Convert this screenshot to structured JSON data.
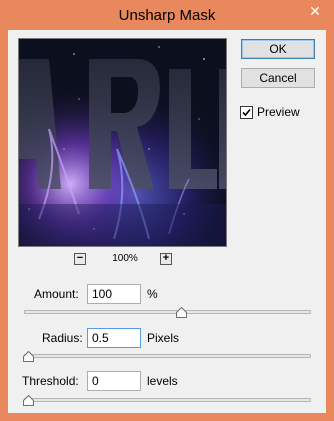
{
  "window": {
    "title": "Unsharp Mask",
    "close_glyph": "✕"
  },
  "buttons": {
    "ok": "OK",
    "cancel": "Cancel"
  },
  "preview_checkbox": {
    "label": "Preview",
    "checked": true
  },
  "zoom": {
    "minus": "−",
    "plus": "+",
    "level": "100%"
  },
  "amount": {
    "label": "Amount:",
    "value": "100",
    "unit": "%",
    "slider_fraction": 0.55
  },
  "radius": {
    "label": "Radius:",
    "value": "0.5",
    "unit": "Pixels",
    "slider_fraction": 0.0
  },
  "threshold": {
    "label": "Threshold:",
    "value": "0",
    "unit": "levels",
    "slider_fraction": 0.0
  },
  "colors": {
    "title_bar": "#e8885c",
    "dialog_bg": "#f0f0f0",
    "focus_border": "#569de5"
  }
}
